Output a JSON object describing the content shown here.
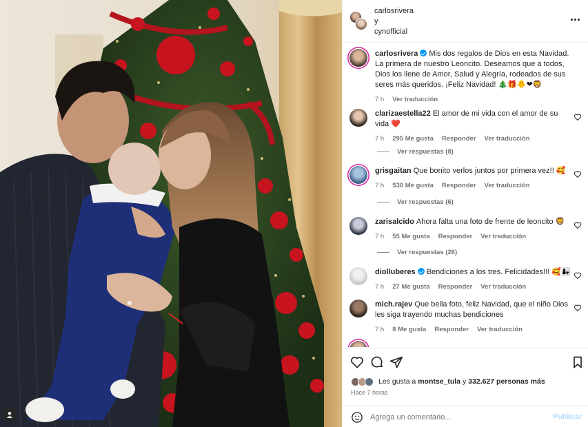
{
  "post": {
    "authors": [
      "carlosrivera",
      "y",
      "cynofficial"
    ],
    "more_icon": "more-horizontal-icon"
  },
  "caption": {
    "user": "carlosrivera",
    "verified": true,
    "text": "Mis dos regalos de Dios en esta Navidad. La primera de nuestro Leoncito. Deseamos que a todos, Dios los llene de Amor, Salud y Alegría, rodeados de sus seres más queridos. ¡Feliz Navidad! 🎄🎁🐥❤🦁",
    "time": "7 h",
    "translate": "Ver traducción"
  },
  "comments": [
    {
      "user": "clarizaestella22",
      "text": "El amor de mi vida con el amor de su vida ❤️",
      "time": "7 h",
      "likes": "295 Me gusta",
      "reply": "Responder",
      "translate": "Ver traducción",
      "replies": "Ver respuestas (8)"
    },
    {
      "user": "grisgaitan",
      "text": "Que bonito verlos juntos por primera vez!! 🥰",
      "time": "7 h",
      "likes": "530 Me gusta",
      "reply": "Responder",
      "translate": "Ver traducción",
      "replies": "Ver respuestas (6)"
    },
    {
      "user": "zarisalcido",
      "text": "Ahora falta una foto de frente de leoncito 🦁",
      "time": "7 h",
      "likes": "55 Me gusta",
      "reply": "Responder",
      "translate": "Ver traducción",
      "replies": "Ver respuestas (26)"
    },
    {
      "user": "diolluberes",
      "verified": true,
      "text": "Bendiciones a los tres. Felicidades!!! 🥰👩‍👧",
      "time": "7 h",
      "likes": "27 Me gusta",
      "reply": "Responder",
      "translate": "Ver traducción"
    },
    {
      "user": "mich.rajev",
      "text": "Que bella foto, feliz Navidad, que el niño Dios les siga trayendo muchas bendiciones",
      "time": "7 h",
      "likes": "8 Me gusta",
      "reply": "Responder",
      "translate": "Ver traducción"
    }
  ],
  "actions": {
    "like_icon": "heart-icon",
    "comment_icon": "comment-icon",
    "share_icon": "share-icon",
    "save_icon": "bookmark-icon"
  },
  "likes": {
    "prefix": "Les gusta a",
    "first_user": "montse_tula",
    "middle": "y",
    "count": "332.627 personas más"
  },
  "timestamp": "Hace 7 horas",
  "add_comment": {
    "placeholder": "Agrega un comentario...",
    "publish": "Publicar"
  },
  "colors": {
    "accent": "#0095f6",
    "publish_disabled": "#b3dbff",
    "muted_text": "#737373"
  }
}
